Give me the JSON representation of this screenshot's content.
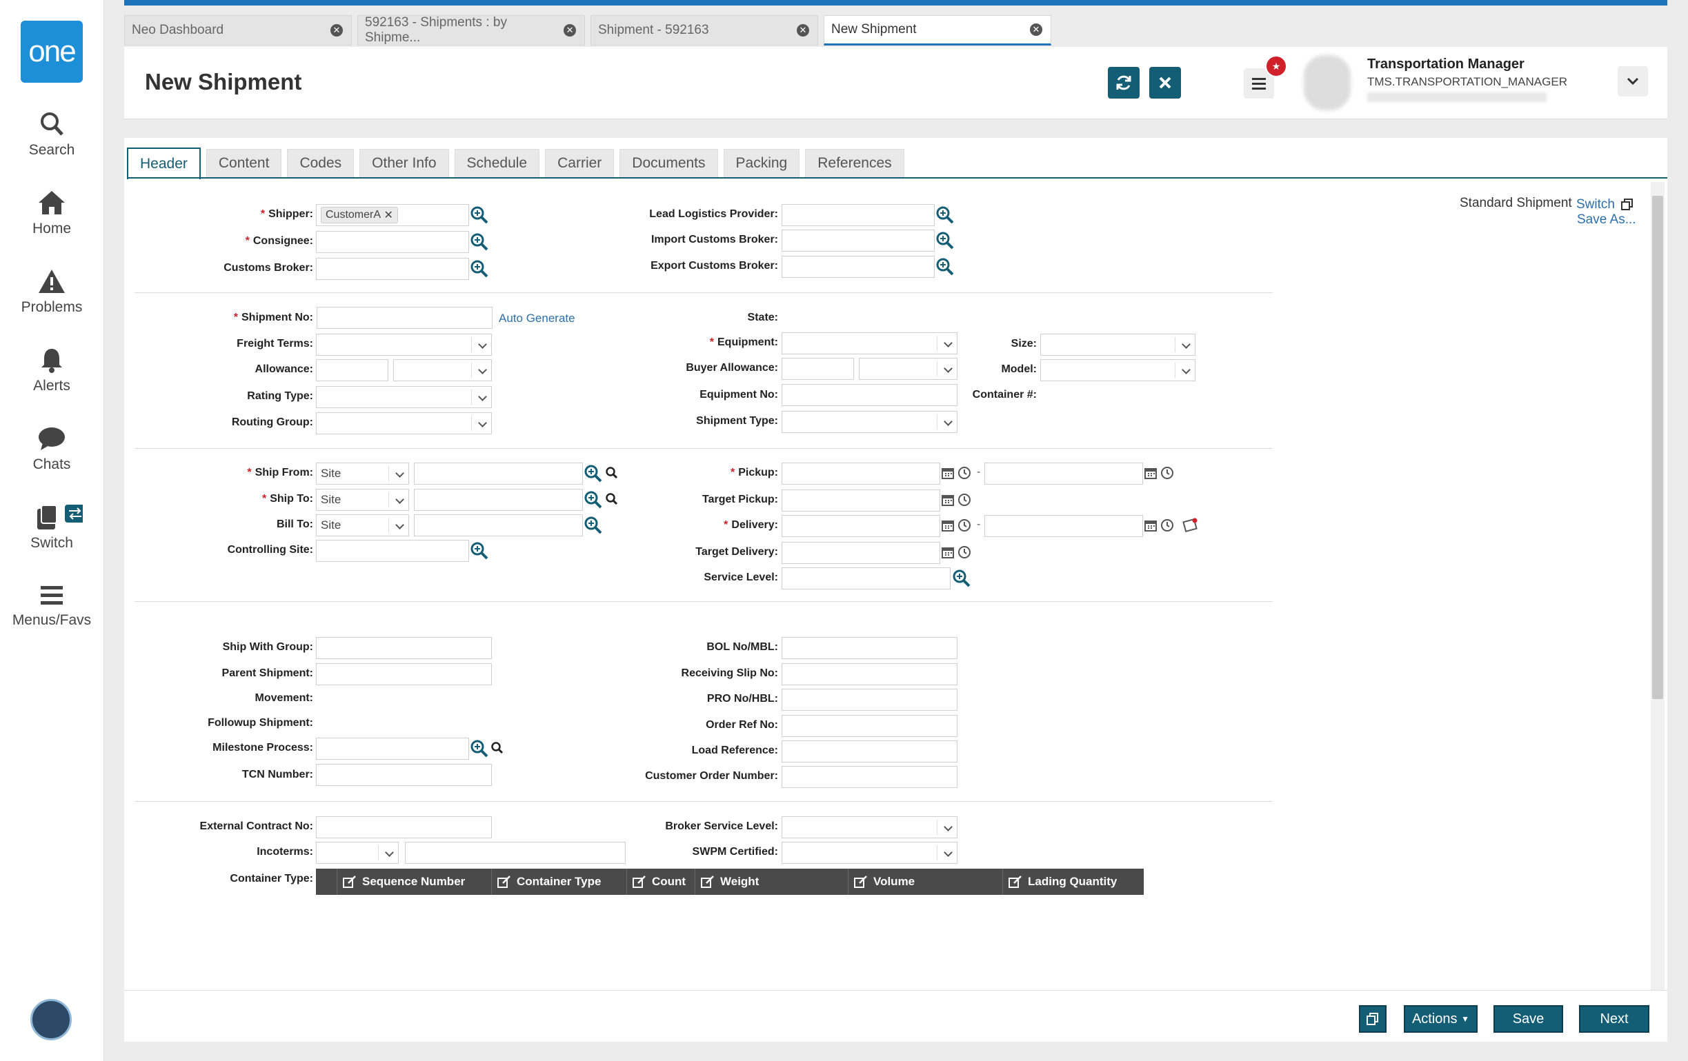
{
  "sidebar": {
    "logo": "one",
    "items": [
      {
        "label": "Search",
        "icon": "search-icon"
      },
      {
        "label": "Home",
        "icon": "home-icon"
      },
      {
        "label": "Problems",
        "icon": "warning-icon"
      },
      {
        "label": "Alerts",
        "icon": "bell-icon"
      },
      {
        "label": "Chats",
        "icon": "chat-icon"
      },
      {
        "label": "Switch",
        "icon": "switch-icon"
      },
      {
        "label": "Menus/Favs",
        "icon": "menu-icon"
      }
    ]
  },
  "page_tabs": [
    {
      "label": "Neo Dashboard"
    },
    {
      "label": "592163 - Shipments : by Shipme..."
    },
    {
      "label": "Shipment - 592163"
    },
    {
      "label": "New Shipment"
    }
  ],
  "header": {
    "title": "New Shipment",
    "user_name": "Transportation Manager",
    "user_role": "TMS.TRANSPORTATION_MANAGER"
  },
  "form_tabs": [
    "Header",
    "Content",
    "Codes",
    "Other Info",
    "Schedule",
    "Carrier",
    "Documents",
    "Packing",
    "References"
  ],
  "form": {
    "shipper_label": "Shipper:",
    "shipper_value": "CustomerA",
    "consignee_label": "Consignee:",
    "customs_broker_label": "Customs Broker:",
    "llp_label": "Lead Logistics Provider:",
    "import_broker_label": "Import Customs Broker:",
    "export_broker_label": "Export Customs Broker:",
    "shipment_no_label": "Shipment No:",
    "auto_generate": "Auto Generate",
    "freight_terms_label": "Freight Terms:",
    "allowance_label": "Allowance:",
    "rating_type_label": "Rating Type:",
    "routing_group_label": "Routing Group:",
    "state_label": "State:",
    "equipment_label": "Equipment:",
    "buyer_allowance_label": "Buyer Allowance:",
    "equipment_no_label": "Equipment No:",
    "shipment_type_label": "Shipment Type:",
    "size_label": "Size:",
    "model_label": "Model:",
    "container_no_label": "Container #:",
    "ship_from_label": "Ship From:",
    "ship_to_label": "Ship To:",
    "bill_to_label": "Bill To:",
    "site_value": "Site",
    "controlling_site_label": "Controlling Site:",
    "pickup_label": "Pickup:",
    "target_pickup_label": "Target Pickup:",
    "delivery_label": "Delivery:",
    "target_delivery_label": "Target Delivery:",
    "service_level_label": "Service Level:",
    "dash": "-",
    "ship_with_group_label": "Ship With Group:",
    "parent_shipment_label": "Parent Shipment:",
    "movement_label": "Movement:",
    "followup_label": "Followup Shipment:",
    "milestone_label": "Milestone Process:",
    "tcn_label": "TCN Number:",
    "bol_label": "BOL No/MBL:",
    "receiving_slip_label": "Receiving Slip No:",
    "pro_label": "PRO No/HBL:",
    "order_ref_label": "Order Ref No:",
    "load_ref_label": "Load Reference:",
    "customer_order_label": "Customer Order Number:",
    "external_contract_label": "External Contract No:",
    "incoterms_label": "Incoterms:",
    "container_type_label": "Container Type:",
    "broker_service_label": "Broker Service Level:",
    "swpm_label": "SWPM Certified:"
  },
  "grid_columns": [
    "Sequence Number",
    "Container Type",
    "Count",
    "Weight",
    "Volume",
    "Lading Quantity"
  ],
  "right_panel": {
    "standard": "Standard Shipment",
    "switch": "Switch",
    "save_as": "Save As..."
  },
  "footer": {
    "actions": "Actions",
    "save": "Save",
    "next": "Next"
  },
  "colors": {
    "accent": "#135d75",
    "brand": "#1d8ed8",
    "required": "#d0202a"
  }
}
